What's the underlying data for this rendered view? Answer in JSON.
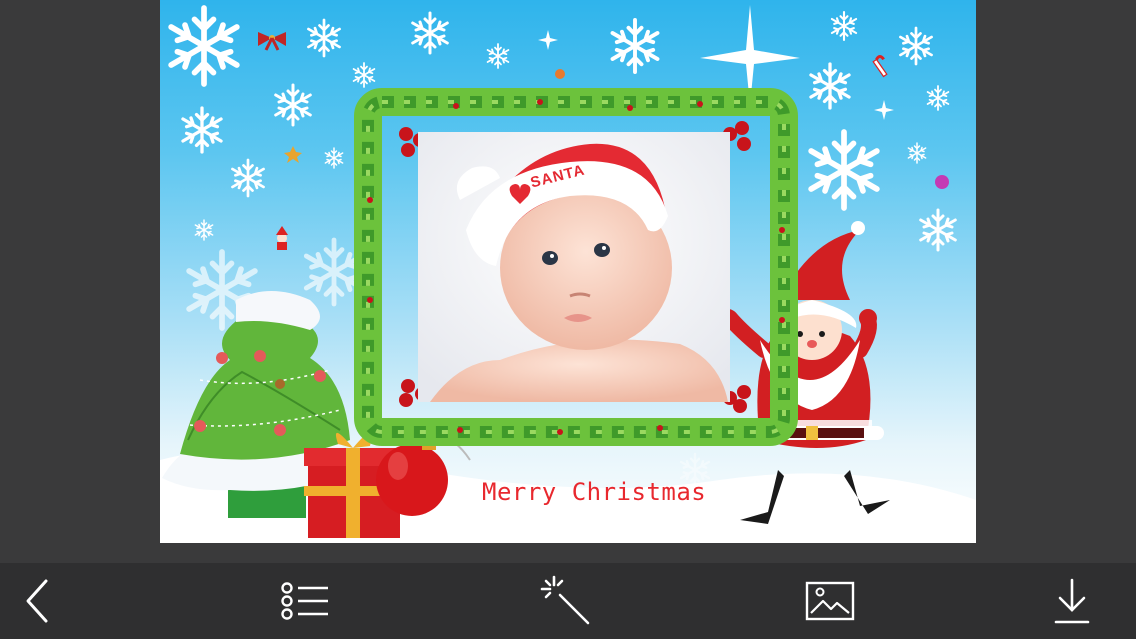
{
  "card": {
    "greeting": "Merry Christmas",
    "hat_text": "SANTA"
  },
  "toolbar": {
    "buttons": [
      {
        "name": "back-button",
        "icon": "chevron-left-icon"
      },
      {
        "name": "frames-list-button",
        "icon": "list-icon"
      },
      {
        "name": "effects-button",
        "icon": "magic-wand-icon"
      },
      {
        "name": "gallery-button",
        "icon": "image-icon"
      },
      {
        "name": "download-button",
        "icon": "download-icon"
      }
    ]
  },
  "colors": {
    "sky_top": "#2fb4ec",
    "sky_bottom": "#ffffff",
    "greeting": "#e8282e",
    "toolbar_bg": "#2f2f30",
    "toolbar_icon": "#ffffff"
  }
}
